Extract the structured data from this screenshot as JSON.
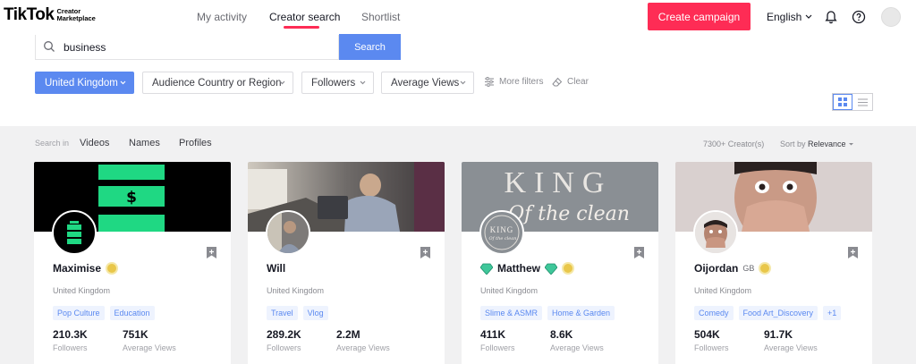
{
  "nav": {
    "logo_main": "TikTok",
    "logo_sub_1": "Creator",
    "logo_sub_2": "Marketplace",
    "tabs": [
      "My activity",
      "Creator search",
      "Shortlist"
    ],
    "active_tab": "Creator search",
    "create_label": "Create campaign",
    "language": "English",
    "accent_color": "#fe2c55"
  },
  "search": {
    "value": "business",
    "button_label": "Search"
  },
  "filters": {
    "items": [
      "United Kingdom",
      "Audience Country or Region",
      "Followers",
      "Average Views"
    ],
    "more_filters": "More filters",
    "clear": "Clear",
    "primary_color": "#5b89f0"
  },
  "results": {
    "search_in_label": "Search in",
    "search_in_options": [
      "Videos",
      "Names",
      "Profiles"
    ],
    "count": "7300+ Creator(s)",
    "sort_label": "Sort by",
    "sort_value": "Relevance"
  },
  "cards": [
    {
      "name": "Maximise",
      "country_code": "",
      "country": "United Kingdom",
      "tags": [
        "Pop Culture",
        "Education"
      ],
      "followers": "210.3K",
      "followers_label": "Followers",
      "avg_views": "751K",
      "avg_views_label": "Average Views"
    },
    {
      "name": "Will",
      "country_code": "",
      "country": "United Kingdom",
      "tags": [
        "Travel",
        "Vlog"
      ],
      "followers": "289.2K",
      "followers_label": "Followers",
      "avg_views": "2.2M",
      "avg_views_label": "Average Views"
    },
    {
      "name": "Matthew",
      "country_code": "",
      "country": "United Kingdom",
      "tags": [
        "Slime & ASMR",
        "Home & Garden"
      ],
      "followers": "411K",
      "followers_label": "Followers",
      "avg_views": "8.6K",
      "avg_views_label": "Average Views",
      "cover_text_1": "KING",
      "cover_text_2": "Of the clean",
      "avatar_text_1": "KING",
      "avatar_text_2": "Of the clean"
    },
    {
      "name": "Oijordan",
      "country_code": "GB",
      "country": "United Kingdom",
      "tags": [
        "Comedy",
        "Food Art_Discovery",
        "+1"
      ],
      "followers": "504K",
      "followers_label": "Followers",
      "avg_views": "91.7K",
      "avg_views_label": "Average Views"
    }
  ]
}
